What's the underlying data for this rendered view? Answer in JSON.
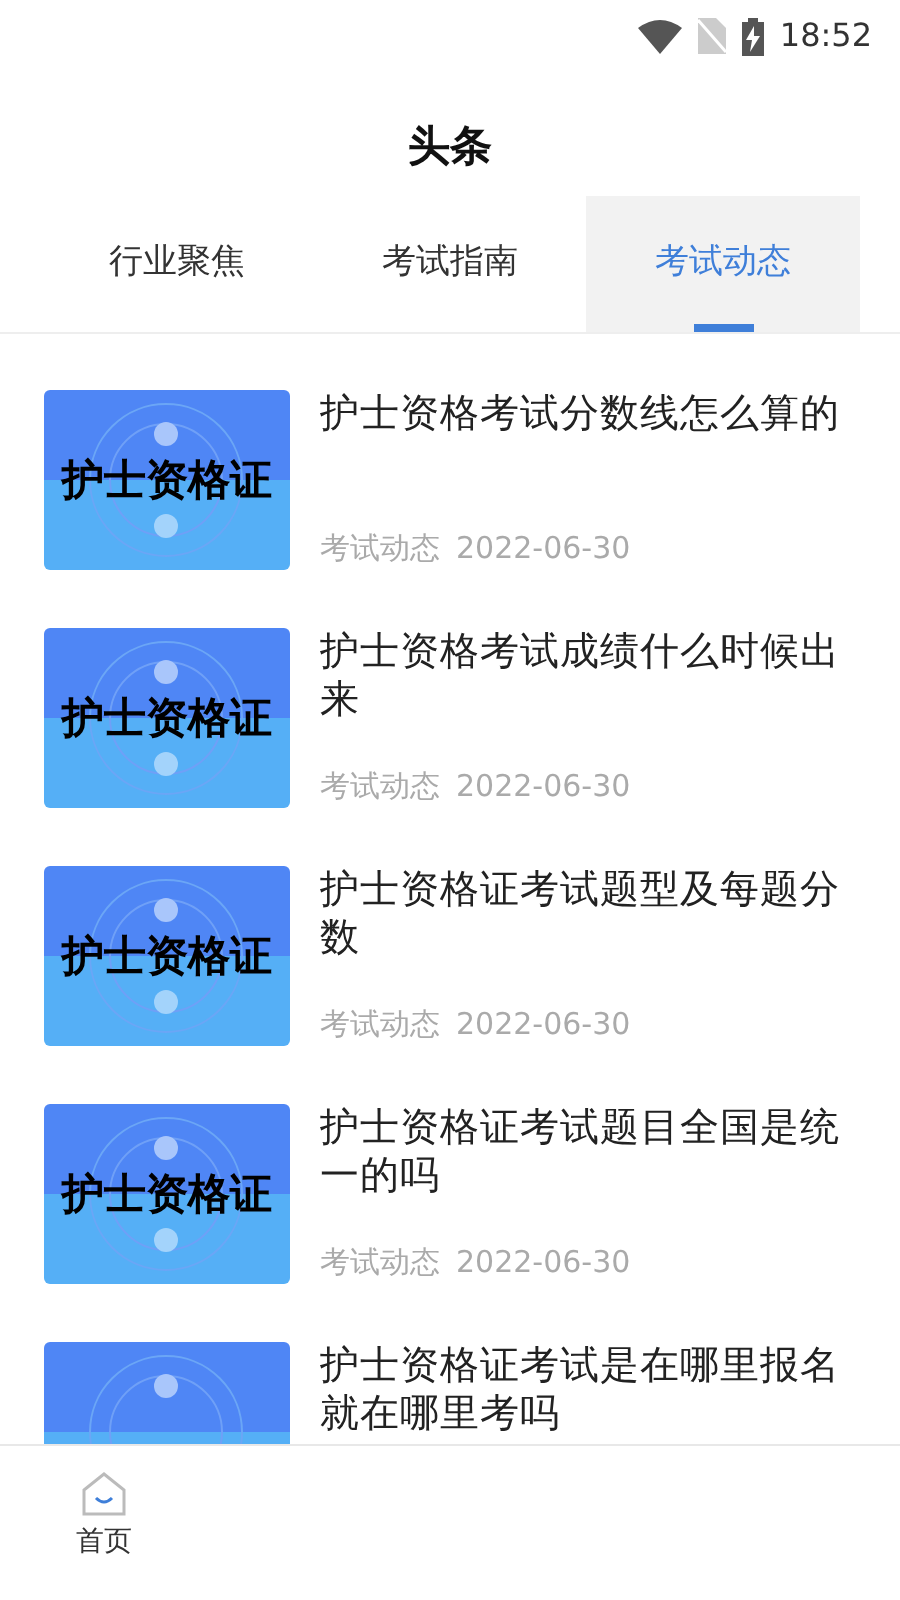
{
  "status_bar": {
    "time": "18:52"
  },
  "title": "头条",
  "tabs": [
    {
      "label": "行业聚焦",
      "selected": false
    },
    {
      "label": "考试指南",
      "selected": false
    },
    {
      "label": "考试动态",
      "selected": true
    }
  ],
  "articles": [
    {
      "thumb_text": "护士资格证",
      "title": "护士资格考试分数线怎么算的",
      "category": "考试动态",
      "date": "2022-06-30"
    },
    {
      "thumb_text": "护士资格证",
      "title": "护士资格考试成绩什么时候出来",
      "category": "考试动态",
      "date": "2022-06-30"
    },
    {
      "thumb_text": "护士资格证",
      "title": "护士资格证考试题型及每题分数",
      "category": "考试动态",
      "date": "2022-06-30"
    },
    {
      "thumb_text": "护士资格证",
      "title": "护士资格证考试题目全国是统一的吗",
      "category": "考试动态",
      "date": "2022-06-30"
    },
    {
      "title": "护士资格证考试是在哪里报名就在哪里考吗"
    }
  ],
  "bottom_nav": [
    {
      "label": "首页",
      "selected": true
    }
  ]
}
